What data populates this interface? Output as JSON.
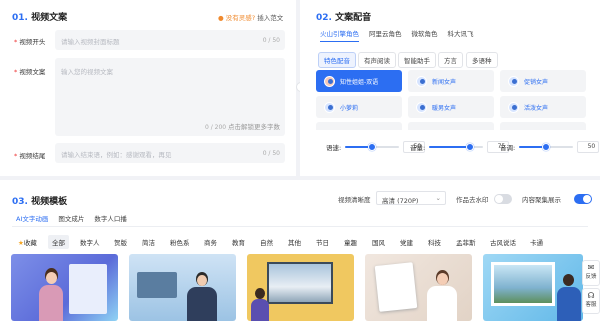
{
  "section1": {
    "num": "01.",
    "title": "视频文案",
    "no_inspiration": "没有灵感?",
    "insert_example": "插入范文",
    "fields": [
      {
        "label": "视频开头",
        "placeholder": "请输入视频封面标题",
        "count": "0 / 50"
      },
      {
        "label": "视频文案",
        "placeholder": "输入您的视频文案",
        "count": "0 / 200",
        "hint": "点击解锁更多字数"
      },
      {
        "label": "视频结尾",
        "placeholder": "请输入结束语，例如：感谢观看，再见",
        "count": "0 / 50"
      }
    ]
  },
  "section2": {
    "num": "02.",
    "title": "文案配音",
    "providers": [
      "火山引擎角色",
      "阿里云角色",
      "微软角色",
      "科大讯飞"
    ],
    "categories": [
      "特色配音",
      "有声阅读",
      "智能助手",
      "方言",
      "多语种"
    ],
    "voices": [
      "知性姐姐-双语",
      "新闻女声",
      "促销女声",
      "小萝莉",
      "暖男女声",
      "活泼女声"
    ],
    "sliders": [
      {
        "label": "语速:",
        "value": 50
      },
      {
        "label": "音量:",
        "value": 75
      },
      {
        "label": "音调:",
        "value": 50
      }
    ]
  },
  "section3": {
    "num": "03.",
    "title": "视频模板",
    "resolution_label": "视频清晰度",
    "resolution_value": "高清 (720P)",
    "watermark_label": "作品去水印",
    "watermark_on": false,
    "subtitle_label": "内容聚集展示",
    "subtitle_on": true,
    "tabs": [
      "AI文字动画",
      "图文成片",
      "数字人口播"
    ],
    "categories": [
      "收藏",
      "全部",
      "数字人",
      "贺版",
      "简洁",
      "粉色系",
      "商务",
      "教育",
      "自然",
      "其他",
      "节日",
      "童趣",
      "国风",
      "党建",
      "科技",
      "孟菲斯",
      "古风说话",
      "卡通"
    ]
  },
  "side": {
    "feedback": "反馈",
    "help": "客服"
  },
  "colors": {
    "accent": "#2c6ef2",
    "star": "#e33333"
  }
}
